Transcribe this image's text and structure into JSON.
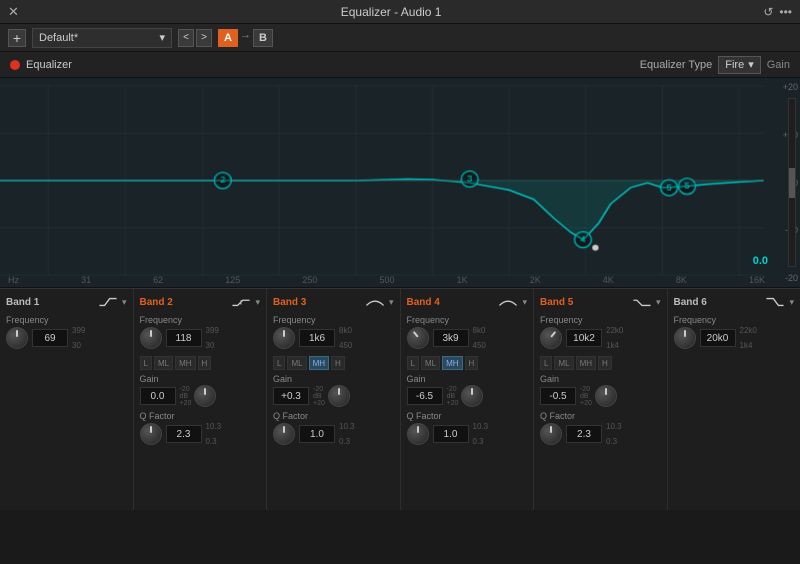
{
  "titleBar": {
    "title": "Equalizer - Audio 1",
    "closeLabel": "✕",
    "historyIcon": "↺",
    "menuIcon": "•••"
  },
  "toolbar": {
    "addLabel": "+",
    "preset": "Default*",
    "navLeft": "<",
    "navRight": ">",
    "btnA": "A",
    "btnArrow": "→",
    "btnB": "B"
  },
  "eqHeader": {
    "dotColor": "#e03020",
    "label": "Equalizer",
    "typeLabel": "Equalizer Type",
    "typeValue": "Fire",
    "gainLabel": "Gain"
  },
  "graph": {
    "dbLabels": [
      "+20",
      "+10",
      "0",
      "-10",
      "-20"
    ],
    "freqLabels": [
      "Hz",
      "31",
      "62",
      "125",
      "250",
      "500",
      "1K",
      "2K",
      "4K",
      "8K",
      "16K"
    ],
    "dbValue": "0.0"
  },
  "bands": [
    {
      "name": "Band 1",
      "active": false,
      "typeIcon": "highpass",
      "frequency": {
        "label": "Frequency",
        "value": "69",
        "min": "30",
        "max": "399"
      },
      "hasFreqButtons": false,
      "hasGain": false,
      "hasQFactor": false
    },
    {
      "name": "Band 2",
      "active": true,
      "typeIcon": "lowshelf",
      "frequency": {
        "label": "Frequency",
        "value": "118",
        "min": "30",
        "max": "399"
      },
      "hasFreqButtons": true,
      "freqButtons": [
        "L",
        "ML",
        "MH",
        "H"
      ],
      "activeFreqBtn": -1,
      "hasGain": true,
      "gain": {
        "label": "Gain",
        "value": "0.0",
        "min": "-20",
        "unit": "dB",
        "max": "+20"
      },
      "hasQFactor": true,
      "qFactor": {
        "label": "Q Factor",
        "value": "2.3",
        "min": "0.3",
        "max": "10.3"
      }
    },
    {
      "name": "Band 3",
      "active": true,
      "typeIcon": "bell",
      "frequency": {
        "label": "Frequency",
        "value": "1k6",
        "min": "450",
        "max": "8k0"
      },
      "hasFreqButtons": true,
      "freqButtons": [
        "L",
        "ML",
        "MH",
        "H"
      ],
      "activeFreqBtn": 2,
      "hasGain": true,
      "gain": {
        "label": "Gain",
        "value": "+0.3",
        "min": "-20",
        "unit": "dB",
        "max": "+20"
      },
      "hasQFactor": true,
      "qFactor": {
        "label": "Q Factor",
        "value": "1.0",
        "min": "0.3",
        "max": "10.3"
      }
    },
    {
      "name": "Band 4",
      "active": true,
      "typeIcon": "bell",
      "frequency": {
        "label": "Frequency",
        "value": "3k9",
        "min": "450",
        "max": "8k0"
      },
      "hasFreqButtons": true,
      "freqButtons": [
        "L",
        "ML",
        "MH",
        "H"
      ],
      "activeFreqBtn": 2,
      "hasGain": true,
      "gain": {
        "label": "Gain",
        "value": "-6.5",
        "min": "-20",
        "unit": "dB",
        "max": "+20"
      },
      "hasQFactor": true,
      "qFactor": {
        "label": "Q Factor",
        "value": "1.0",
        "min": "0.3",
        "max": "10.3"
      }
    },
    {
      "name": "Band 5",
      "active": true,
      "typeIcon": "highshelf",
      "frequency": {
        "label": "Frequency",
        "value": "10k2",
        "min": "1k4",
        "max": "22k0"
      },
      "hasFreqButtons": true,
      "freqButtons": [
        "L",
        "ML",
        "MH",
        "H"
      ],
      "activeFreqBtn": -1,
      "hasGain": true,
      "gain": {
        "label": "Gain",
        "value": "-0.5",
        "min": "-20",
        "unit": "dB",
        "max": "+20"
      },
      "hasQFactor": true,
      "qFactor": {
        "label": "Q Factor",
        "value": "2.3",
        "min": "0.3",
        "max": "10.3"
      }
    },
    {
      "name": "Band 6",
      "active": false,
      "typeIcon": "lowpass",
      "frequency": {
        "label": "Frequency",
        "value": "20k0",
        "min": "1k4",
        "max": "22k0"
      },
      "hasFreqButtons": false,
      "hasGain": false,
      "hasQFactor": false
    }
  ]
}
